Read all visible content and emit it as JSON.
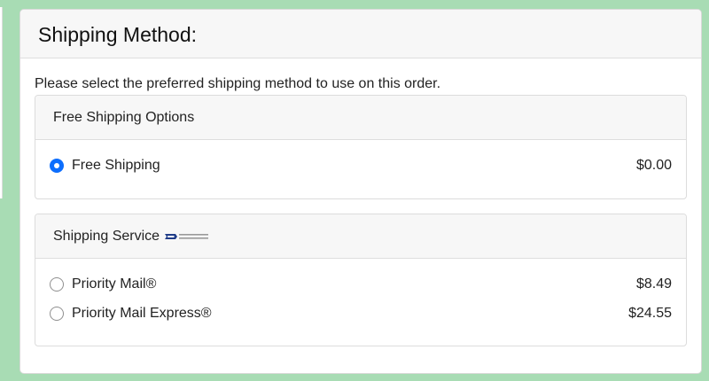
{
  "shipping": {
    "title": "Shipping Method:",
    "instructions": "Please select the preferred shipping method to use on this order.",
    "groups": [
      {
        "header": "Free Shipping Options",
        "options": [
          {
            "label": "Free Shipping",
            "price": "$0.00",
            "selected": true
          }
        ]
      },
      {
        "header": "Shipping Service",
        "logo_icon": "usps-logo-icon",
        "logo_text": "UNITED STATES POSTAL SERVICE",
        "options": [
          {
            "label": "Priority Mail®",
            "price": "$8.49",
            "selected": false
          },
          {
            "label": "Priority Mail Express®",
            "price": "$24.55",
            "selected": false
          }
        ]
      }
    ]
  },
  "colors": {
    "background": "#a8dcb4",
    "accent": "#0d6efd",
    "header_bg": "#f7f7f7"
  }
}
